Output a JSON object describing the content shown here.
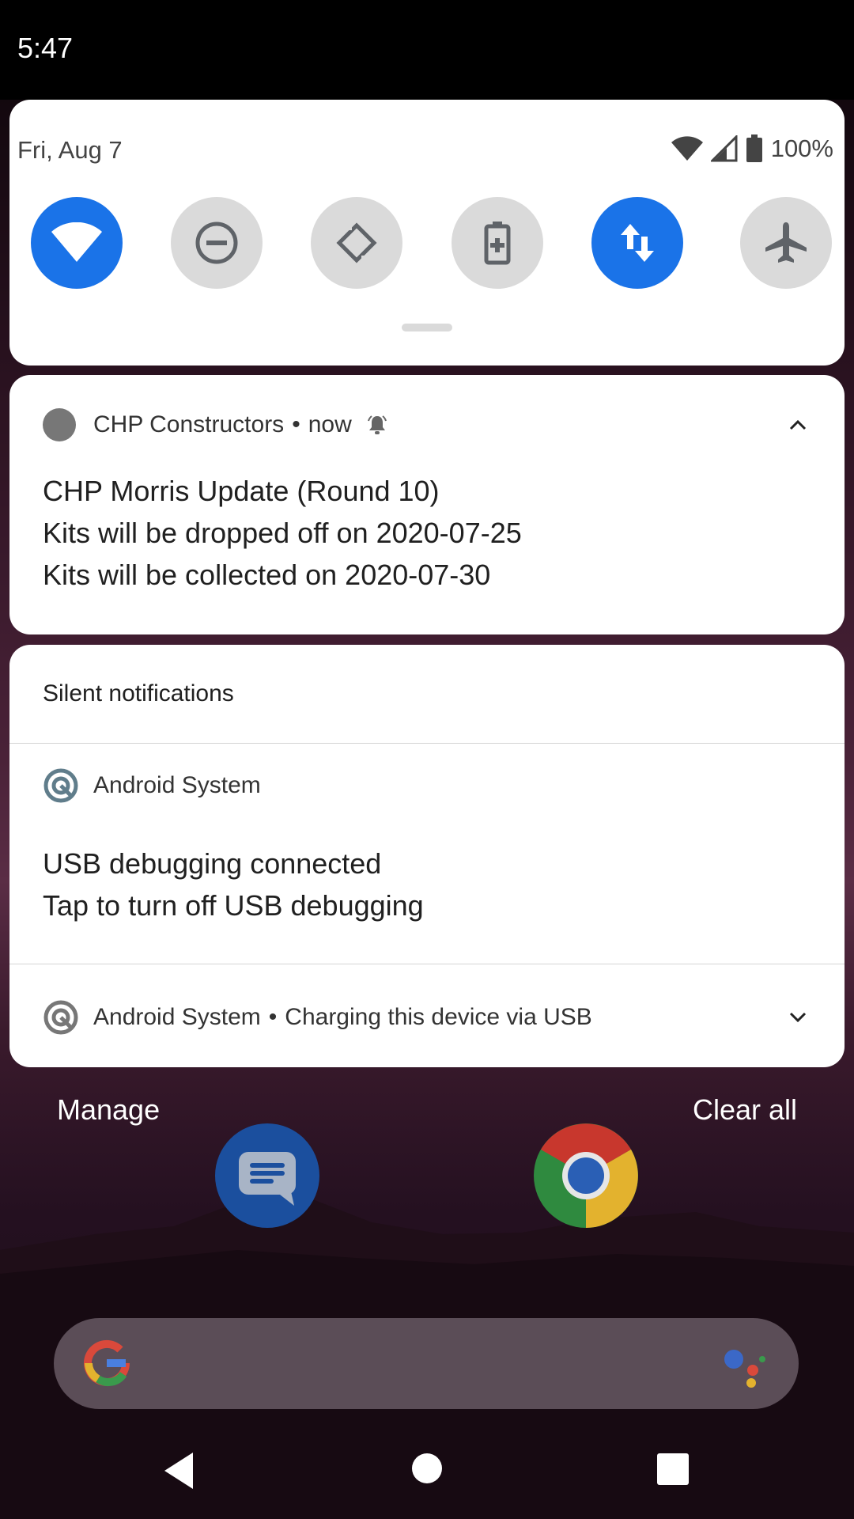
{
  "status_bar": {
    "time": "5:47"
  },
  "quick_settings": {
    "date": "Fri, Aug 7",
    "battery": "100%",
    "tiles": [
      {
        "icon": "wifi-icon",
        "active": true
      },
      {
        "icon": "do-not-disturb-icon",
        "active": false
      },
      {
        "icon": "auto-rotate-icon",
        "active": false
      },
      {
        "icon": "battery-saver-icon",
        "active": false
      },
      {
        "icon": "mobile-data-icon",
        "active": true
      },
      {
        "icon": "airplane-mode-icon",
        "active": false
      }
    ],
    "accent_color": "#1a73e8"
  },
  "notification": {
    "app_name": "CHP Constructors",
    "time": "now",
    "lines": [
      "CHP Morris Update (Round 10)",
      "Kits will be dropped off on 2020-07-25",
      "Kits will be collected on 2020-07-30"
    ]
  },
  "silent": {
    "title": "Silent notifications",
    "items": [
      {
        "app_name": "Android System",
        "title": "USB debugging connected",
        "text": "Tap to turn off USB debugging"
      },
      {
        "app_name": "Android System",
        "summary": "Charging this device via USB"
      }
    ]
  },
  "footer": {
    "manage": "Manage",
    "clear_all": "Clear all"
  }
}
